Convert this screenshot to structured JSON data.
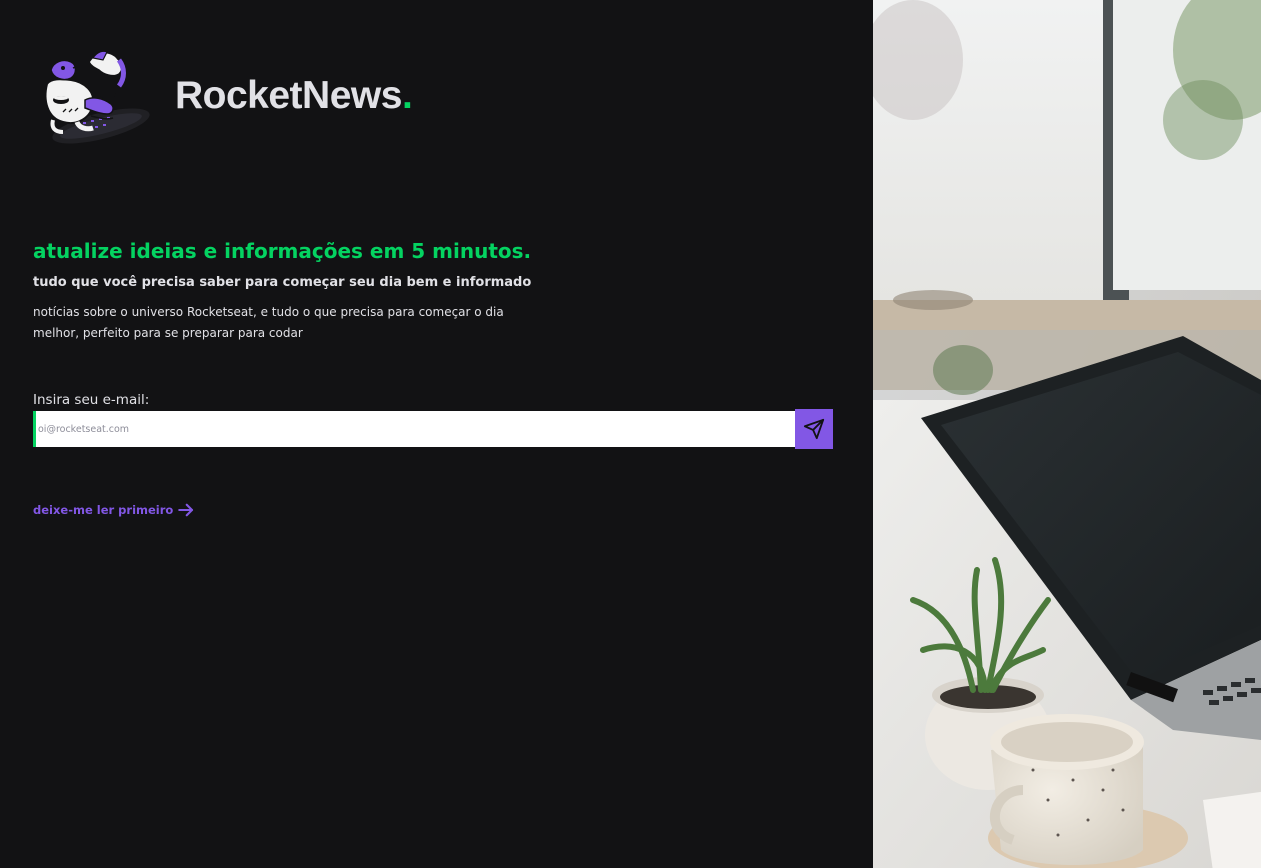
{
  "brand": {
    "name": "RocketNews",
    "dot": ".",
    "accent_color": "#04d361"
  },
  "hero": {
    "headline": "atualize ideias e informações em 5 minutos.",
    "subheadline": "tudo que você precisa saber para começar seu dia bem e informado",
    "description": "notícias sobre o universo Rocketseat, e tudo o que precisa para começar o dia melhor, perfeito para se preparar para codar"
  },
  "form": {
    "email_label": "Insira seu e-mail:",
    "email_placeholder": "oi@rocketseat.com",
    "email_value": "",
    "submit_icon": "send-icon"
  },
  "links": {
    "read_first": "deixe-me ler primeiro",
    "read_first_icon": "arrow-right-icon"
  },
  "colors": {
    "background": "#121214",
    "primary": "#8257e5",
    "accent": "#04d361",
    "text": "#e1e1e6"
  },
  "images": {
    "mascot": "rocketseat-mascot-illustration",
    "side_photo": "laptop-plant-mug-desk-photo"
  }
}
